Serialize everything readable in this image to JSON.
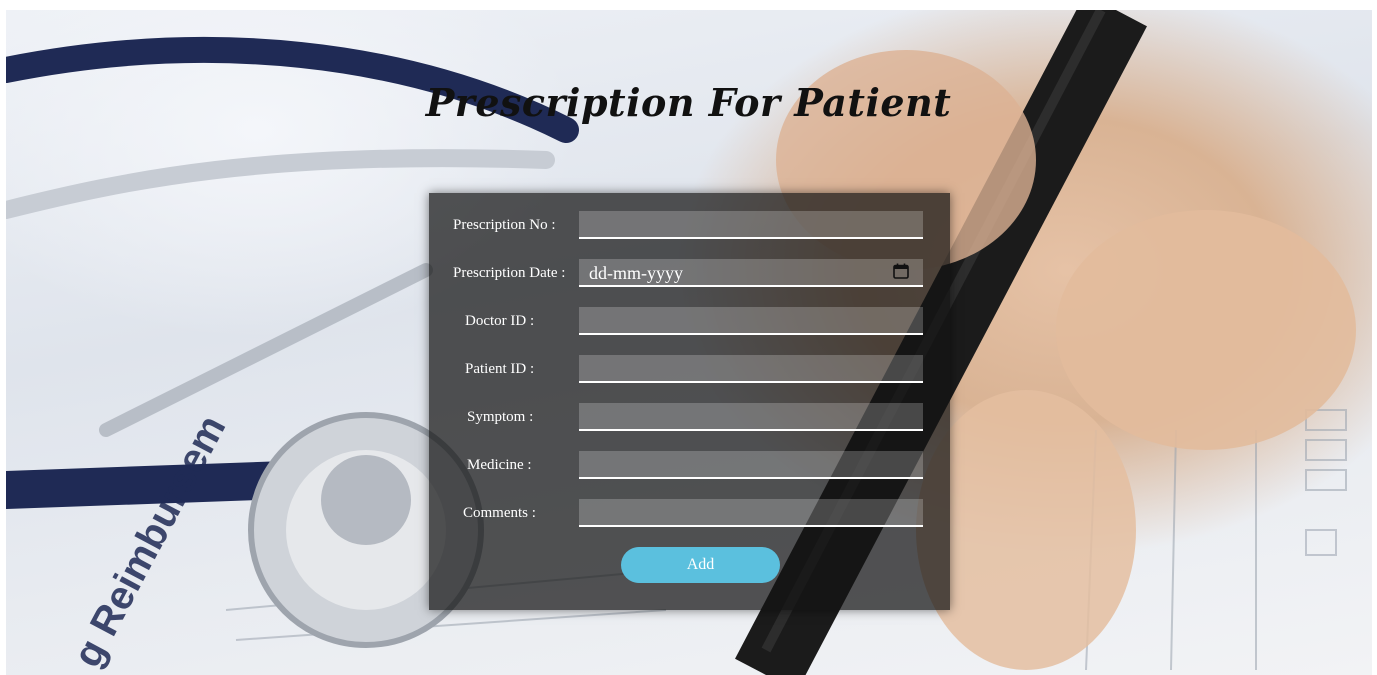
{
  "page": {
    "title": "Prescription For Patient"
  },
  "form": {
    "fields": [
      {
        "label": "Prescription No :",
        "value": "",
        "placeholder": ""
      },
      {
        "label": "Prescription Date :",
        "value": "dd-mm-yyyy",
        "placeholder": "dd-mm-yyyy",
        "icon": "calendar-icon"
      },
      {
        "label": "Doctor ID :",
        "value": "",
        "placeholder": ""
      },
      {
        "label": "Patient ID :",
        "value": "",
        "placeholder": ""
      },
      {
        "label": "Symptom :",
        "value": "",
        "placeholder": ""
      },
      {
        "label": "Medicine :",
        "value": "",
        "placeholder": ""
      },
      {
        "label": "Comments :",
        "value": "",
        "placeholder": ""
      }
    ],
    "submit_label": "Add"
  },
  "colors": {
    "button": "#5bc0de",
    "panel": "rgba(20,20,20,0.72)"
  }
}
